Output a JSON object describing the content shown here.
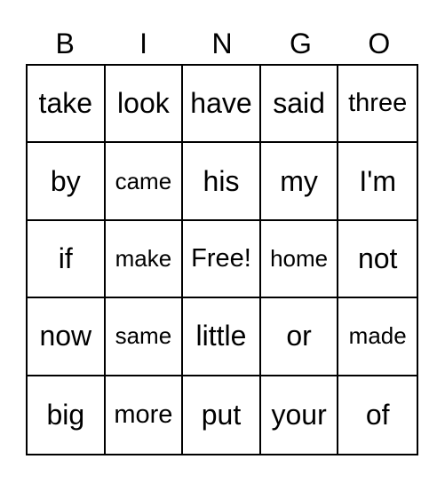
{
  "header": [
    "B",
    "I",
    "N",
    "G",
    "O"
  ],
  "cells": [
    [
      "take",
      "look",
      "have",
      "said",
      "three"
    ],
    [
      "by",
      "came",
      "his",
      "my",
      "I'm"
    ],
    [
      "if",
      "make",
      "Free!",
      "home",
      "not"
    ],
    [
      "now",
      "same",
      "little",
      "or",
      "made"
    ],
    [
      "big",
      "more",
      "put",
      "your",
      "of"
    ]
  ]
}
